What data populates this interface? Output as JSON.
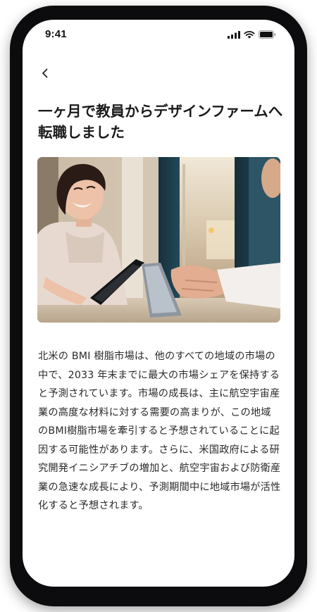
{
  "status_bar": {
    "time": "9:41",
    "icons": [
      "cellular-signal-icon",
      "wifi-icon",
      "battery-icon"
    ]
  },
  "nav": {
    "back_icon": "chevron-left-icon"
  },
  "article": {
    "title": "一ヶ月で教員からデザインファームへ転職しました",
    "body": "北米の BMI 樹脂市場は、他のすべての地域の市場の中で、2033 年末までに最大の市場シェアを保持すると予測されています。市場の成長は、主に航空宇宙産業の高度な材料に対する需要の高まりが、この地域のBMI樹脂市場を牽引すると予想されていることに起因する可能性があります。さらに、米国政府による研究開発イニシアチブの増加と、航空宇宙および防衛産業の急速な成長により、予測期間中に地域市場が活性化すると予想されます。"
  },
  "colors": {
    "frame": "#0c0c0e",
    "screen": "#ffffff",
    "text": "#2a2a2a",
    "title": "#1b1b1b"
  }
}
